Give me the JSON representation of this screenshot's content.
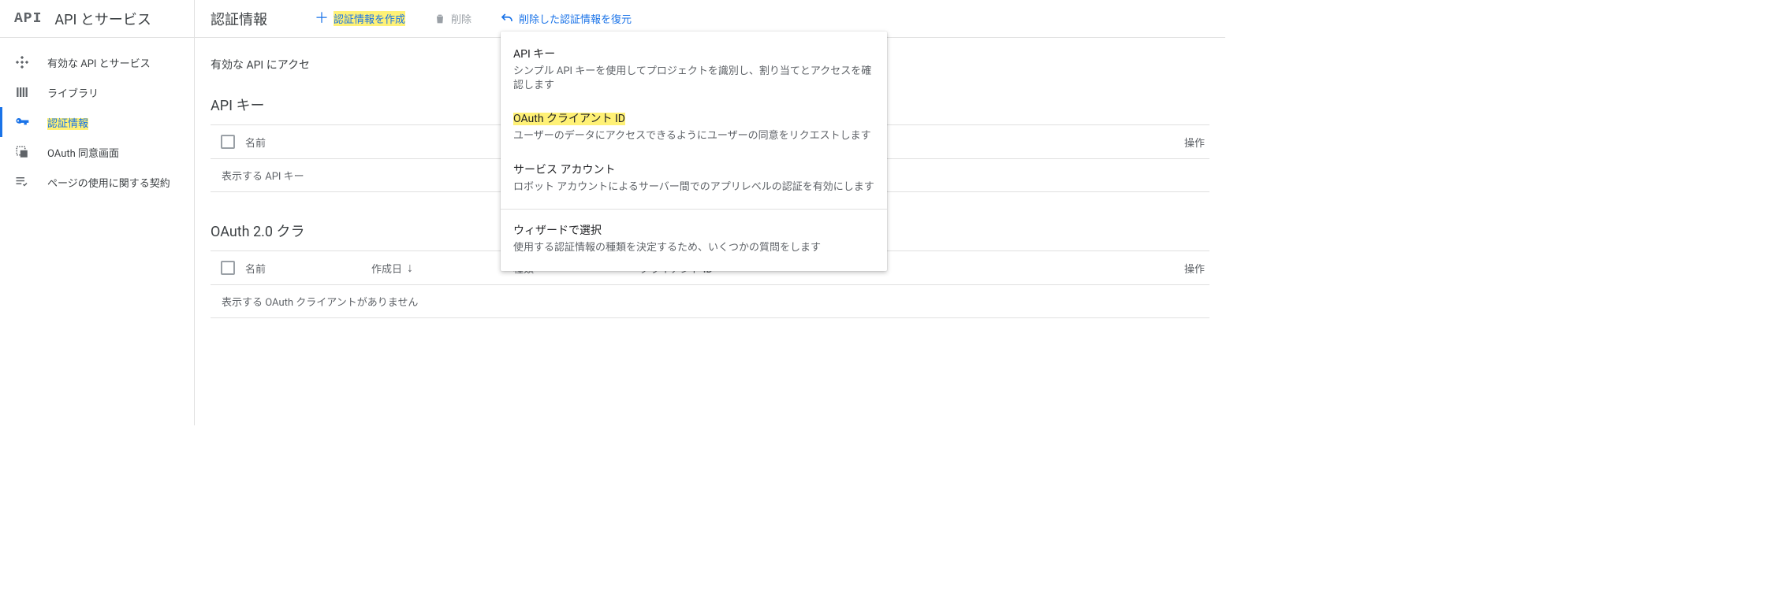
{
  "product": {
    "logo": "API",
    "title": "API とサービス"
  },
  "sidebar": {
    "items": [
      {
        "label": "有効な API とサービス"
      },
      {
        "label": "ライブラリ"
      },
      {
        "label": "認証情報"
      },
      {
        "label": "OAuth 同意画面"
      },
      {
        "label": "ページの使用に関する契約"
      }
    ]
  },
  "toolbar": {
    "page_title": "認証情報",
    "create_label": "認証情報を作成",
    "delete_label": "削除",
    "restore_label": "削除した認証情報を復元"
  },
  "intro_truncated": "有効な API にアクセ",
  "sections": {
    "api_keys": {
      "title": "API キー",
      "columns": {
        "name": "名前",
        "ops": "操作"
      },
      "empty_truncated": "表示する API キー"
    },
    "oauth_clients": {
      "title_truncated": "OAuth 2.0 クラ",
      "columns": {
        "name": "名前",
        "created": "作成日",
        "type": "種類",
        "client_id": "クライアント ID",
        "ops": "操作"
      },
      "empty": "表示する OAuth クライアントがありません"
    }
  },
  "dropdown": {
    "items": [
      {
        "title": "API キー",
        "desc": "シンプル API キーを使用してプロジェクトを識別し、割り当てとアクセスを確認します"
      },
      {
        "title": "OAuth クライアント ID",
        "desc": "ユーザーのデータにアクセスできるようにユーザーの同意をリクエストします"
      },
      {
        "title": "サービス アカウント",
        "desc": "ロボット アカウントによるサーバー間でのアプリレベルの認証を有効にします"
      },
      {
        "title": "ウィザードで選択",
        "desc": "使用する認証情報の種類を決定するため、いくつかの質問をします"
      }
    ]
  }
}
